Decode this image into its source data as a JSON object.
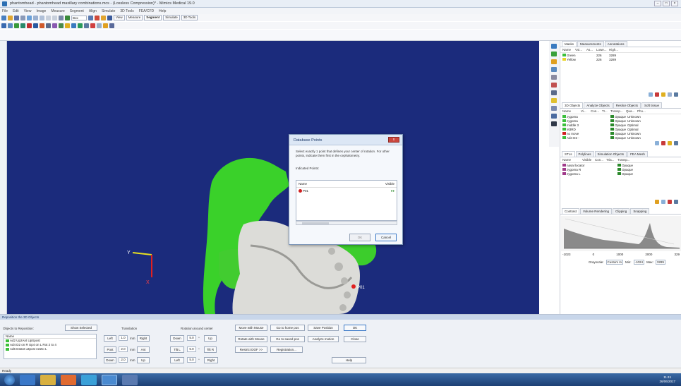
{
  "window": {
    "title": "phantomhead - phantomhead maxillary combinations.mcs - (Lossless Compression)* - Mimics Medical 19.0",
    "controls": [
      "–",
      "□",
      "×"
    ]
  },
  "menu": [
    "File",
    "Edit",
    "View",
    "Image",
    "Measure",
    "Segment",
    "Align",
    "Simulate",
    "3D Tools",
    "FEA/CFD",
    "Help"
  ],
  "toolbar": {
    "box_combo": "Box",
    "tabs": [
      "View",
      "Measure",
      "Segment",
      "Simulate",
      "3D Tools"
    ],
    "active_tab": "Segment"
  },
  "viewport": {
    "axis_y_label": "Y",
    "axis_x_label": "X",
    "point_label": "P01"
  },
  "dialog": {
    "title": "Database Points",
    "close": "x",
    "instruction": "Select exactly 1 point that defines your center of rotation. For other points, indicate them first in the cephalometry.",
    "indicated_label": "Indicated Points:",
    "col_name": "Name",
    "col_visible": "Visible",
    "point_name": "P01",
    "ok": "OK",
    "cancel": "Cancel"
  },
  "masks": {
    "tabs": [
      "Masks",
      "Measurements",
      "Annotations"
    ],
    "headers": [
      "Name",
      "Vsi...",
      "As...",
      "Lowe...",
      "High..."
    ],
    "rows": [
      {
        "name": "Green",
        "color": "#3bbf3b",
        "low": "226",
        "high": "3289"
      },
      {
        "name": "Yellow",
        "color": "#e8d42a",
        "low": "226",
        "high": "3289"
      }
    ]
  },
  "objects3d": {
    "tabs": [
      "3D Objects",
      "Analyze Objects",
      "Reslice Objects",
      "Soft tissue"
    ],
    "headers": [
      "Name",
      "Vi...",
      "Con...",
      "Tr...",
      "Transp...",
      "Qua...",
      "Pho..."
    ],
    "rows": [
      {
        "name": "zygoma",
        "color": "#3bbf3b",
        "transp": "Opaque",
        "qual": "Unknown"
      },
      {
        "name": "zygoma",
        "color": "#3bbf3b",
        "transp": "Opaque",
        "qual": "Unknown"
      },
      {
        "name": "middle 3",
        "color": "#3bbf3b",
        "transp": "Opaque",
        "qual": "Optimal"
      },
      {
        "name": "M3RD",
        "color": "#3bbf3b",
        "transp": "Opaque",
        "qual": "Optimal"
      },
      {
        "name": "no move",
        "color": "#d02020",
        "transp": "Opaque",
        "qual": "Unknown"
      },
      {
        "name": "Ad4 D2 -",
        "color": "#3bbf3b",
        "transp": "Opaque",
        "qual": "Unknown"
      }
    ]
  },
  "stls": {
    "tabs": [
      "STLs",
      "Polylines",
      "Simulation Objects",
      "FEA Mesh"
    ],
    "headers": [
      "Name",
      "Visible",
      "Con...",
      "Tria...",
      "Transp..."
    ],
    "rows": [
      {
        "name": "nasal locator",
        "transp": "Opaque"
      },
      {
        "name": "zygoma R",
        "transp": "Opaque"
      },
      {
        "name": "zygoma L",
        "transp": "Opaque"
      }
    ]
  },
  "contrast": {
    "tabs": [
      "Contrast",
      "Volume Rendering",
      "Clipping",
      "Snapping"
    ],
    "ticks": [
      "-1023",
      "0",
      "1000",
      "2000",
      "329"
    ],
    "grayscale_label": "Grayscale:",
    "grayscale_value": "Custom m",
    "min_label": "Min:",
    "min_value": "-1024",
    "max_label": "Max:",
    "max_value": "3289"
  },
  "reposition": {
    "header": "Reposition the 3D Objects",
    "objects_label": "Objects to Reposition:",
    "show_selected": "Show Selected",
    "list_header": "Name",
    "objects": [
      "Ad2 Up2Ant UpSpost",
      "Ad4 D2 on R Up4 on L Rot 2 to 4",
      "Ad6 D3ant u3post rot2to L"
    ],
    "translation_label": "Translation",
    "rotation_label": "Rotation around center",
    "trans": [
      {
        "btn1": "Left",
        "val": "1.0",
        "unit": "mm",
        "btn2": "Right"
      },
      {
        "btn1": "Post",
        "val": "2.0",
        "unit": "mm",
        "btn2": "Ant"
      },
      {
        "btn1": "Down",
        "val": "2.0",
        "unit": "mm",
        "btn2": "Up"
      }
    ],
    "rot": [
      {
        "btn1": "Down",
        "val": "5.0",
        "unit": "°",
        "btn2": "Up"
      },
      {
        "btn1": "Tilt L",
        "val": "5.0",
        "unit": "°",
        "btn2": "Tilt R"
      },
      {
        "btn1": "Left",
        "val": "5.0",
        "unit": "°",
        "btn2": "Right"
      }
    ],
    "move_with_mouse": "Move with Mouse",
    "go_home": "Go to home pos",
    "save_position": "Save Position",
    "ok": "OK",
    "rotate_with_mouse": "Rotate with Mouse",
    "go_saved": "Go to saved pos",
    "analyze_motion": "Analyze motion",
    "close": "Close",
    "restrict_dof": "Restrict DOF >>",
    "registration": "Registration...",
    "help": "Help"
  },
  "status": "Ready",
  "taskbar": {
    "time": "11:41",
    "date": "26/06/2017"
  }
}
